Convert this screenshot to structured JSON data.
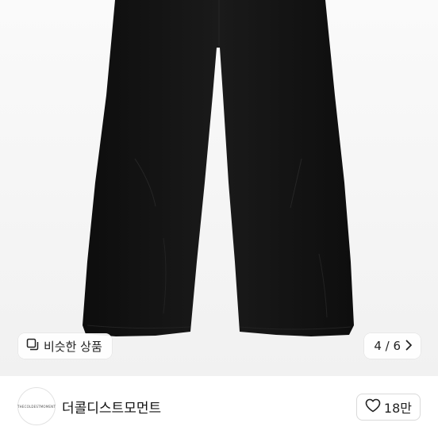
{
  "photo": {
    "alt": "",
    "background": "#f5f5f5",
    "garment_color": "#121212"
  },
  "similar": {
    "label": "비슷한 상품",
    "icon": "similar-items-icon"
  },
  "pager": {
    "text": "4 / 6",
    "icon": "chevron-right-icon"
  },
  "store": {
    "name": "더콜디스트모먼트",
    "logo_text": "THECOLDESTMOMENT"
  },
  "like": {
    "count": "18만",
    "icon": "heart-icon"
  }
}
